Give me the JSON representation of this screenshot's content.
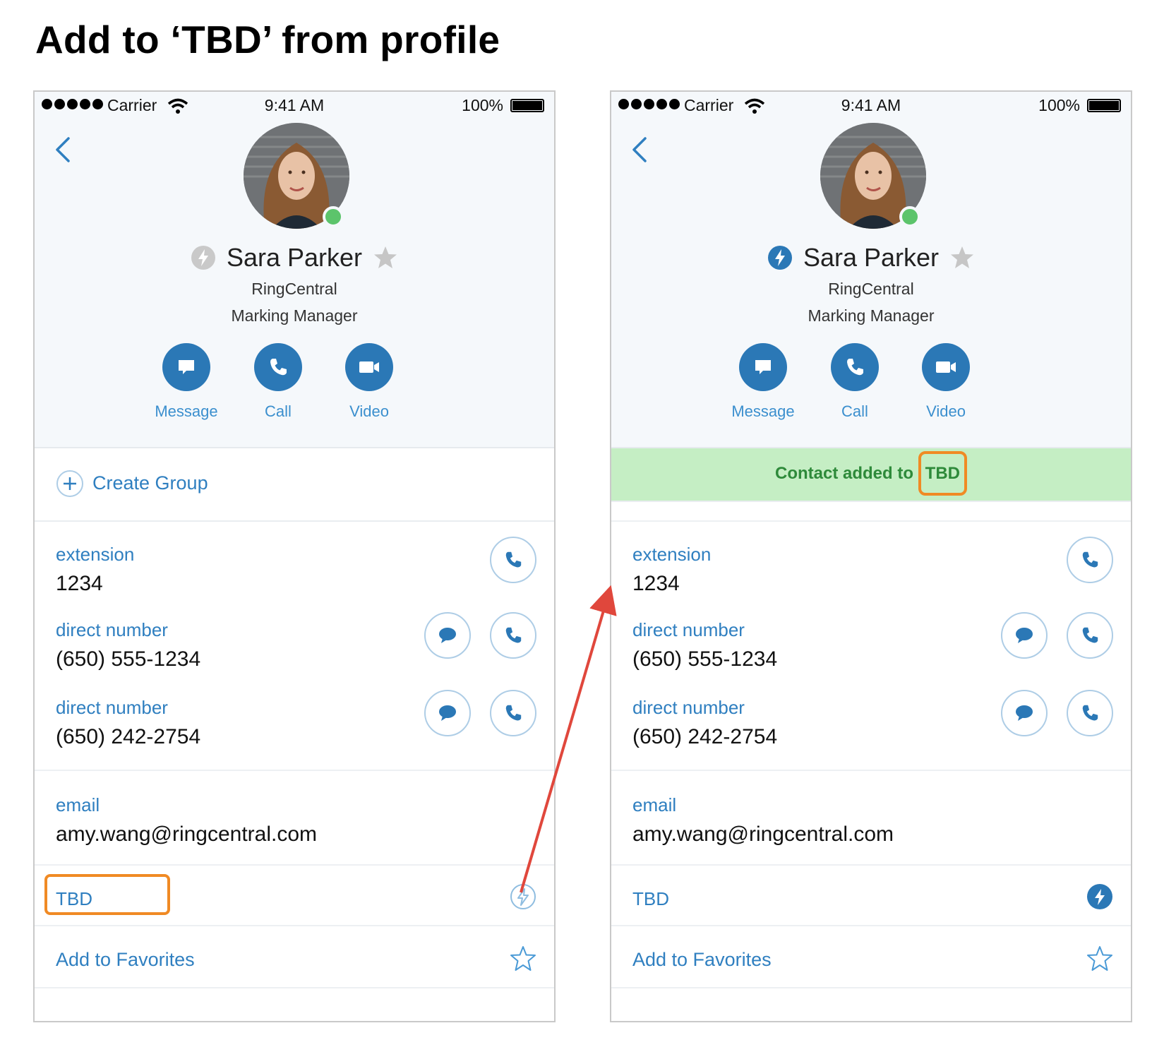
{
  "page": {
    "title": "Add to ‘TBD’ from profile"
  },
  "screens": [
    {
      "status": {
        "carrier": "Carrier",
        "time": "9:41 AM",
        "battery": "100%"
      },
      "profile": {
        "name": "Sara Parker",
        "company": "RingCentral",
        "job_title": "Marking Manager",
        "favorite_status": "not-favorite"
      },
      "actions": {
        "message": "Message",
        "call": "Call",
        "video": "Video"
      },
      "create_group": "Create Group",
      "fields": {
        "extension_label": "extension",
        "extension_value": "1234",
        "direct1_label": "direct number",
        "direct1_value": "(650) 555-1234",
        "direct2_label": "direct number",
        "direct2_value": "(650) 242-2754",
        "email_label": "email",
        "email_value": "amy.wang@ringcentral.com"
      },
      "tbd_row": {
        "label": "TBD",
        "state": "inactive"
      },
      "favorites": {
        "label": "Add to Favorites"
      }
    },
    {
      "status": {
        "carrier": "Carrier",
        "time": "9:41 AM",
        "battery": "100%"
      },
      "profile": {
        "name": "Sara Parker",
        "company": "RingCentral",
        "job_title": "Marking Manager",
        "favorite_status": "not-favorite"
      },
      "actions": {
        "message": "Message",
        "call": "Call",
        "video": "Video"
      },
      "banner": {
        "prefix": "Contact added to ",
        "highlight": "TBD",
        "color": "#c5eec4"
      },
      "fields": {
        "extension_label": "extension",
        "extension_value": "1234",
        "direct1_label": "direct number",
        "direct1_value": "(650) 555-1234",
        "direct2_label": "direct number",
        "direct2_value": "(650) 242-2754",
        "email_label": "email",
        "email_value": "amy.wang@ringcentral.com"
      },
      "tbd_row": {
        "label": "TBD",
        "state": "active"
      },
      "favorites": {
        "label": "Add to Favorites"
      }
    }
  ],
  "colors": {
    "accent": "#2b78b6",
    "link": "#2f7fc0",
    "highlight": "#f08a24",
    "arrow": "#e0473c",
    "presence": "#5cc46b"
  }
}
